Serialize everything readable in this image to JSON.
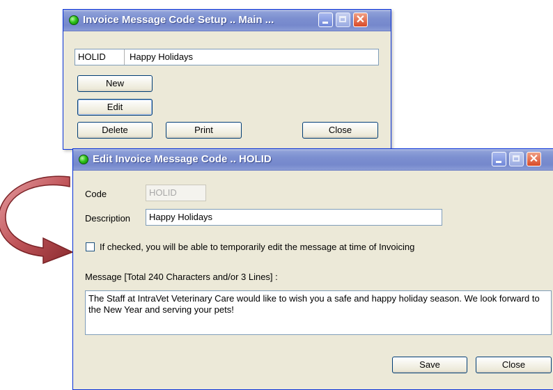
{
  "main_window": {
    "title": "Invoice Message Code Setup .. Main ...",
    "code_value": "HOLID",
    "description_value": "Happy Holidays",
    "buttons": {
      "new": "New",
      "edit": "Edit",
      "delete": "Delete",
      "print": "Print",
      "close": "Close"
    }
  },
  "edit_window": {
    "title": "Edit Invoice Message Code .. HOLID",
    "code_label": "Code",
    "code_value": "HOLID",
    "description_label": "Description",
    "description_value": "Happy Holidays",
    "checkbox_label": "If checked, you will be able to temporarily edit the message at time of Invoicing",
    "checkbox_checked": false,
    "message_label": "Message  [Total 240 Characters and/or 3 Lines] :",
    "message_value": "The Staff at IntraVet Veterinary Care would like to wish you a safe and happy holiday season.  We look forward to the New Year and serving  your pets!",
    "buttons": {
      "save": "Save",
      "close": "Close"
    }
  },
  "colors": {
    "titlebar": "#7c8fd0",
    "window_bg": "#ece9d8",
    "arrow": "#b8474a"
  },
  "icons": [
    "status-green-icon",
    "minimize-icon",
    "maximize-icon",
    "close-icon",
    "curved-arrow-icon"
  ]
}
